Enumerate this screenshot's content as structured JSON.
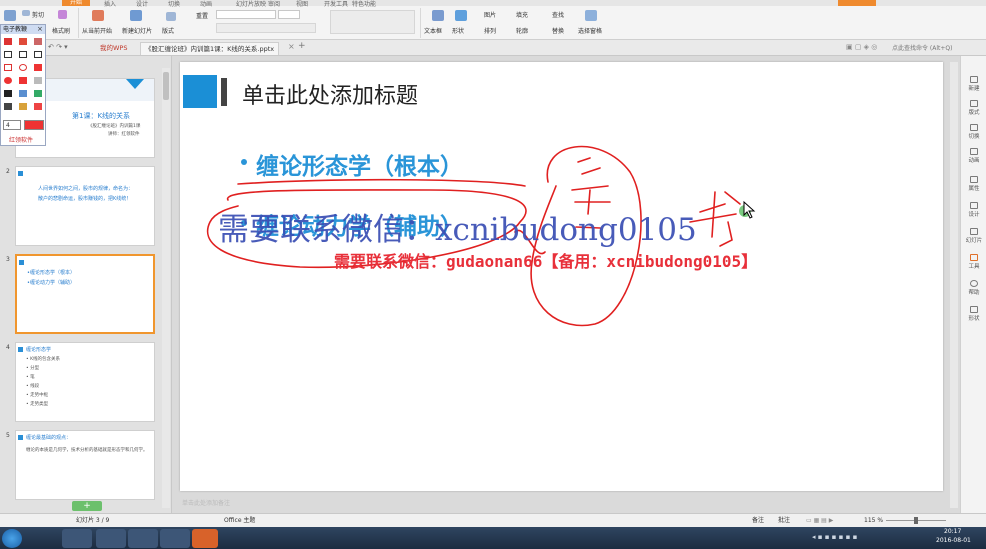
{
  "ribbon": {
    "home_tab": "开始",
    "tabs": [
      "插入",
      "设计",
      "切换",
      "动画",
      "幻灯片放映",
      "审阅",
      "视图",
      "开发工具",
      "特色功能"
    ],
    "buttons": [
      {
        "label": "剪切",
        "icon": "scissors-icon"
      },
      {
        "label": "格式刷",
        "icon": "format-painter-icon"
      },
      {
        "label": "从当前开始",
        "icon": "play-icon"
      },
      {
        "label": "新建幻灯片",
        "icon": "new-slide-icon"
      },
      {
        "label": "版式",
        "icon": "layout-icon"
      },
      {
        "label": "重置",
        "icon": "reset-icon"
      },
      {
        "label": "文本框",
        "icon": "textbox-icon"
      },
      {
        "label": "形状",
        "icon": "shapes-icon"
      },
      {
        "label": "图片",
        "icon": "picture-icon"
      },
      {
        "label": "填充",
        "icon": "fill-icon"
      },
      {
        "label": "排列",
        "icon": "arrange-icon"
      },
      {
        "label": "轮廓",
        "icon": "outline-icon"
      },
      {
        "label": "查找",
        "icon": "find-icon"
      },
      {
        "label": "替换",
        "icon": "replace-icon"
      },
      {
        "label": "选择窗格",
        "icon": "select-pane-icon"
      }
    ]
  },
  "tabbar": {
    "home_tab": "我的WPS",
    "doc_tab": "《股汇缠论班》内训篇1课：K线的关系.pptx",
    "search_placeholder": "点此查找命令 (Alt+Q)"
  },
  "pen_panel": {
    "title": "电子教鞭",
    "line_width": "4",
    "footer": "红领软件"
  },
  "thumbnails": {
    "slide1_title": "第1课：K线的关系",
    "slide1_sub": "《股汇缠论班》内训篇1课",
    "slide1_sub2": "讲师：红领软件",
    "slide2_line1": "人间世界如何之间，股市的规律，命名为：",
    "slide2_line2": "散户的悲剧命运，股市赚钱的，把K线统！",
    "slide3_b1": "•缠论形态学（根本）",
    "slide3_b2": "•缠论动力学（辅助）",
    "slide4_title": "缠论形态学",
    "slide4_items": [
      "• K线的包含关系",
      "• 分型",
      "• 笔",
      "• 线段",
      "• 走势中枢",
      "• 走势类型"
    ],
    "slide5_title": "缠论最基础的观点：",
    "slide5_text": "缠论的本质是几何学，技术分析的基础就是形态学和几何学。",
    "nums": [
      "1",
      "2",
      "3",
      "4",
      "5"
    ],
    "add_label": "+"
  },
  "slide": {
    "title": "单击此处添加标题",
    "bullet1": "缠论形态学（根本）",
    "bullet2": "缠论动力学（辅助）"
  },
  "overlay": {
    "ink_text": "需要联系微信：xcnibudong0105",
    "red_watermark": "需要联系微信：gudaonan66【备用：xcnibudong0105】"
  },
  "notes_placeholder": "单击此处添加备注",
  "right_panel": [
    "新建",
    "版式",
    "切换",
    "动画",
    "属性",
    "设计",
    "幻灯片",
    "工具",
    "帮助",
    "形状"
  ],
  "status": {
    "slide_counter": "幻灯片 3 / 9",
    "theme": "Office 主题",
    "notes_btn": "备注",
    "comment_btn": "批注",
    "zoom": "115 %"
  },
  "taskbar": {
    "time": "20:17",
    "date": "2016-08-01"
  },
  "colors": {
    "accent_blue": "#2a95d8",
    "ribbon_orange": "#ef8a2e",
    "ink_red": "#e02020",
    "ink_blue": "#3b4fb4"
  }
}
